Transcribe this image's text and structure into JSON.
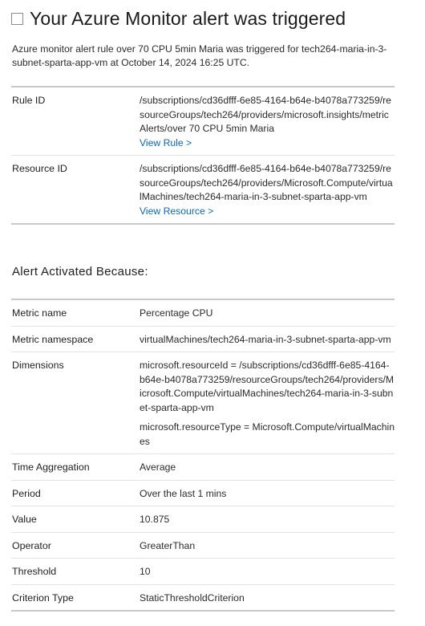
{
  "header": {
    "title": "Your Azure Monitor alert was triggered"
  },
  "intro": "Azure monitor alert rule over 70 CPU 5min Maria was triggered for tech264-maria-in-3-subnet-sparta-app-vm at October 14, 2024 16:25 UTC.",
  "rule": {
    "label": "Rule ID",
    "value": "/subscriptions/cd36dfff-6e85-4164-b64e-b4078a773259/resourceGroups/tech264/providers/microsoft.insights/metricAlerts/over 70 CPU 5min Maria",
    "link": "View Rule >"
  },
  "resource": {
    "label": "Resource ID",
    "value": "/subscriptions/cd36dfff-6e85-4164-b64e-b4078a773259/resourceGroups/tech264/providers/Microsoft.Compute/virtualMachines/tech264-maria-in-3-subnet-sparta-app-vm",
    "link": "View Resource >"
  },
  "section_title": "Alert Activated Because:",
  "metrics": {
    "metric_name": {
      "label": "Metric name",
      "value": "Percentage CPU"
    },
    "metric_namespace": {
      "label": "Metric namespace",
      "value": "virtualMachines/tech264-maria-in-3-subnet-sparta-app-vm"
    },
    "dimensions": {
      "label": "Dimensions",
      "resource_id": "microsoft.resourceId = /subscriptions/cd36dfff-6e85-4164-b64e-b4078a773259/resourceGroups/tech264/providers/Microsoft.Compute/virtualMachines/tech264-maria-in-3-subnet-sparta-app-vm",
      "resource_type": "microsoft.resourceType = Microsoft.Compute/virtualMachines"
    },
    "time_aggregation": {
      "label": "Time Aggregation",
      "value": "Average"
    },
    "period": {
      "label": "Period",
      "value": "Over the last 1 mins"
    },
    "value": {
      "label": "Value",
      "value": "10.875"
    },
    "operator": {
      "label": "Operator",
      "value": "GreaterThan"
    },
    "threshold": {
      "label": "Threshold",
      "value": "10"
    },
    "criterion_type": {
      "label": "Criterion Type",
      "value": "StaticThresholdCriterion"
    }
  }
}
